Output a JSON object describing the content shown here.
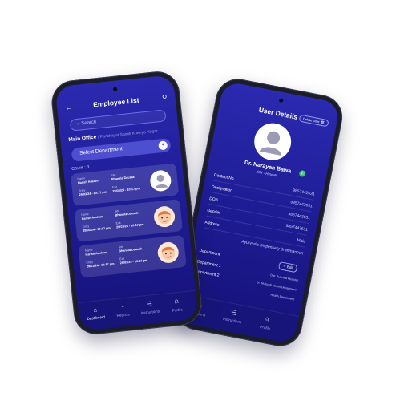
{
  "employee_list": {
    "title": "Employee List",
    "search_placeholder": "Search",
    "office_label": "Main Office",
    "office_sub": "| Panchayat Samiti Kheriya Nagar",
    "select_department": "Select Department",
    "count_label": "Count : 3",
    "cards": [
      {
        "name_label": "Name",
        "name": "Harish Adelum",
        "site_label": "Site",
        "site": "Bhansla Dauzak",
        "entry_label": "Entry",
        "entry": "29/03/24 - 10:17 pm",
        "exit_label": "Exit",
        "exit": "29/03/24 - 10:17 pm",
        "avatar_icon": "user-placeholder-icon"
      },
      {
        "name_label": "Name",
        "name": "Harish Adelum",
        "site_label": "Site",
        "site": "Bhansla Dauzak",
        "entry_label": "Entry",
        "entry": "29/03/24 - 10:17 pm",
        "exit_label": "Exit",
        "exit": "29/03/24 - 10:17 pm",
        "avatar_icon": "cartoon-face-icon"
      },
      {
        "name_label": "Name",
        "name": "Harish Adelum",
        "site_label": "Site",
        "site": "Bhansla Dauzak",
        "entry_label": "Entry",
        "entry": "29/03/24 - 10:17 pm",
        "exit_label": "Exit",
        "exit": "29/03/24 - 10:17 pm",
        "avatar_icon": "cartoon-face-icon"
      }
    ],
    "nav": [
      "Dashboard",
      "Reports",
      "Instructions",
      "Profile"
    ]
  },
  "user_details": {
    "title": "User Details",
    "delete_label": "Delete User",
    "name": "Dr. Narayan Bawa",
    "role": "ISM - Hindati",
    "rows": [
      {
        "label": "Contact No.",
        "value": "9857442631"
      },
      {
        "label": "Designation",
        "value": "9857442631"
      },
      {
        "label": "DOB",
        "value": "9857442631"
      },
      {
        "label": "Gender",
        "value": "9857442631"
      },
      {
        "label": "Address",
        "value": "Male"
      },
      {
        "label": "",
        "value": "Ayurvedic Dispensary Brahmanpuri"
      }
    ],
    "department_label": "Department",
    "edit_label": "Edit",
    "department_1": "Department 1",
    "department_1_value": "Dist. Ayurved Hospital",
    "department_2": "Department 2",
    "department_2_value": "Dr. Mukundi Health Department",
    "department_3_value": "Health Department",
    "nav": [
      "Reports",
      "Instructions",
      "Profile"
    ]
  },
  "colors": {
    "screen_top": "#2b2ab0",
    "screen_bottom": "#15127a",
    "accent": "#4d4fd0",
    "status_online": "#36c46b"
  }
}
